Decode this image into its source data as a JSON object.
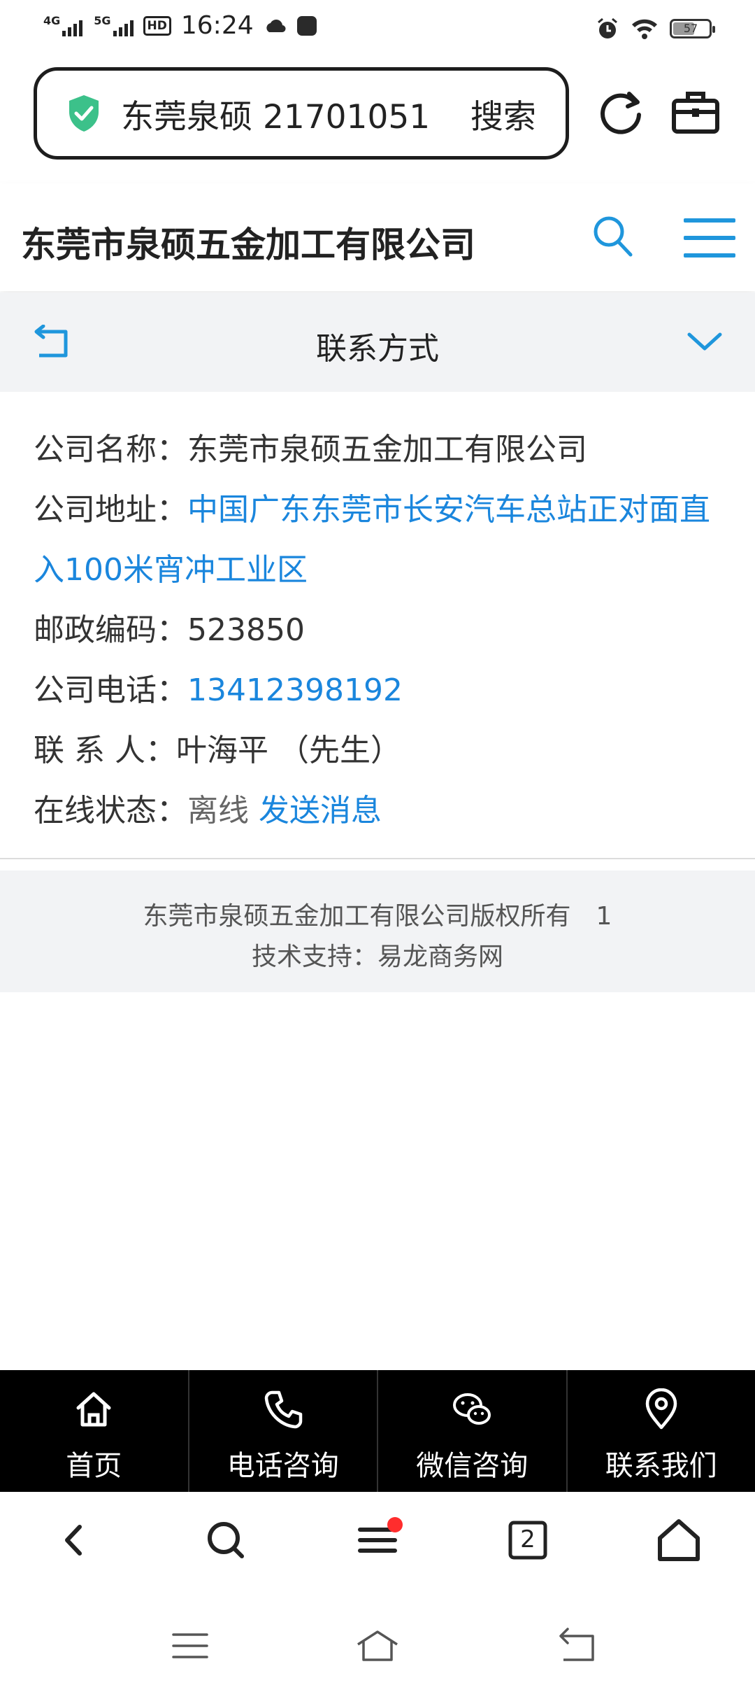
{
  "status_bar": {
    "net1": "4G",
    "net2": "5G",
    "hd": "HD",
    "time": "16:24",
    "battery": "57"
  },
  "address_bar": {
    "query": "东莞泉硕 21701051",
    "search_label": "搜索"
  },
  "header": {
    "title": "东莞市泉硕五金加工有限公司"
  },
  "section": {
    "title": "联系方式"
  },
  "contact": {
    "name_label": "公司名称：",
    "name_value": "东莞市泉硕五金加工有限公司",
    "address_label": "公司地址：",
    "address_value": "中国广东东莞市长安汽车总站正对面直入100米宵冲工业区",
    "postcode_label": "邮政编码：",
    "postcode_value": "523850",
    "phone_label": "公司电话：",
    "phone_value": "13412398192",
    "person_label": "联 系 人：",
    "person_value": "叶海平 （先生）",
    "status_label": "在线状态：",
    "status_value": "离线",
    "send_message": "发送消息"
  },
  "footer": {
    "copyright": "东莞市泉硕五金加工有限公司版权所有　1",
    "support": "技术支持：易龙商务网"
  },
  "action_bar": [
    {
      "label": "首页",
      "icon": "home-icon"
    },
    {
      "label": "电话咨询",
      "icon": "phone-icon"
    },
    {
      "label": "微信咨询",
      "icon": "wechat-icon"
    },
    {
      "label": "联系我们",
      "icon": "location-pin-icon"
    }
  ],
  "browser_nav": {
    "tab_count": "2"
  },
  "colors": {
    "accent": "#1a86dd",
    "shield": "#3cc18a",
    "action_bar_bg": "#000000",
    "badge": "#ff2d2d"
  }
}
